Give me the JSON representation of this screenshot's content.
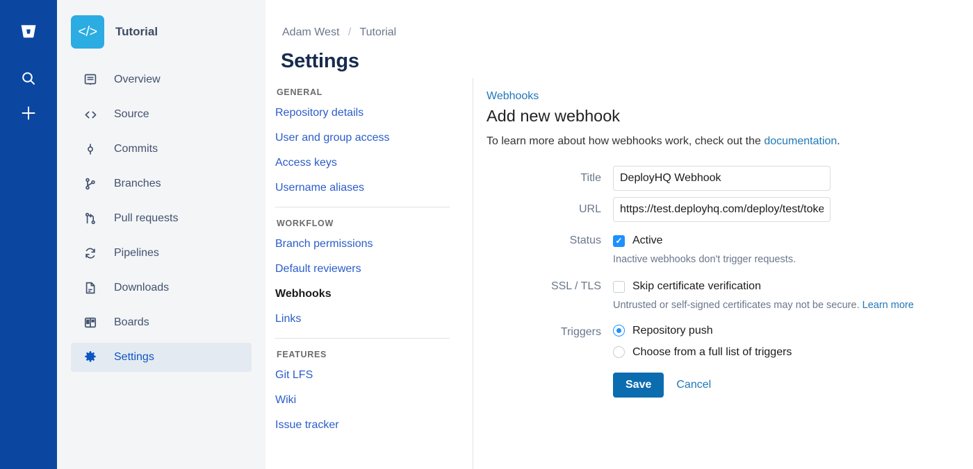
{
  "rail": {
    "logo_icon": "bitbucket-logo",
    "search_icon": "search-icon",
    "create_icon": "plus-icon"
  },
  "sidebar": {
    "repo": {
      "avatar_glyph": "</>",
      "name": "Tutorial"
    },
    "items": [
      {
        "label": "Overview",
        "icon": "overview-icon",
        "active": false
      },
      {
        "label": "Source",
        "icon": "code-icon",
        "active": false
      },
      {
        "label": "Commits",
        "icon": "commits-icon",
        "active": false
      },
      {
        "label": "Branches",
        "icon": "branches-icon",
        "active": false
      },
      {
        "label": "Pull requests",
        "icon": "pull-requests-icon",
        "active": false
      },
      {
        "label": "Pipelines",
        "icon": "pipelines-icon",
        "active": false
      },
      {
        "label": "Downloads",
        "icon": "downloads-icon",
        "active": false
      },
      {
        "label": "Boards",
        "icon": "boards-icon",
        "active": false
      },
      {
        "label": "Settings",
        "icon": "gear-icon",
        "active": true
      }
    ]
  },
  "breadcrumb": {
    "owner": "Adam West",
    "separator": "/",
    "repo": "Tutorial"
  },
  "page": {
    "title": "Settings"
  },
  "settings_nav": {
    "sections": [
      {
        "heading": "GENERAL",
        "links": [
          {
            "label": "Repository details",
            "current": false
          },
          {
            "label": "User and group access",
            "current": false
          },
          {
            "label": "Access keys",
            "current": false
          },
          {
            "label": "Username aliases",
            "current": false
          }
        ]
      },
      {
        "heading": "WORKFLOW",
        "links": [
          {
            "label": "Branch permissions",
            "current": false
          },
          {
            "label": "Default reviewers",
            "current": false
          },
          {
            "label": "Webhooks",
            "current": true
          },
          {
            "label": "Links",
            "current": false
          }
        ]
      },
      {
        "heading": "FEATURES",
        "links": [
          {
            "label": "Git LFS",
            "current": false
          },
          {
            "label": "Wiki",
            "current": false
          },
          {
            "label": "Issue tracker",
            "current": false
          }
        ]
      }
    ]
  },
  "webhook": {
    "eyebrow_link": "Webhooks",
    "title": "Add new webhook",
    "description_before": "To learn more about how webhooks work, check out the ",
    "description_link": "documentation",
    "description_after": ".",
    "fields": {
      "title_label": "Title",
      "title_value": "DeployHQ Webhook",
      "url_label": "URL",
      "url_value": "https://test.deployhq.com/deploy/test/token",
      "status_label": "Status",
      "status_checkbox_label": "Active",
      "status_checked": true,
      "status_helper": "Inactive webhooks don't trigger requests.",
      "ssl_label": "SSL / TLS",
      "ssl_checkbox_label": "Skip certificate verification",
      "ssl_checked": false,
      "ssl_helper_text": "Untrusted or self-signed certificates may not be secure. ",
      "ssl_helper_link": "Learn more",
      "triggers_label": "Triggers",
      "trigger_options": [
        {
          "label": "Repository push",
          "selected": true
        },
        {
          "label": "Choose from a full list of triggers",
          "selected": false
        }
      ]
    },
    "actions": {
      "save_label": "Save",
      "cancel_label": "Cancel"
    }
  },
  "colors": {
    "rail_blue": "#0B47A1",
    "sidebar_bg": "#F4F5F7",
    "repo_avatar": "#2BACE2",
    "link_blue": "#2A5DC8",
    "panel_link_blue": "#2077B8",
    "active_nav_blue": "#0B55C4",
    "active_nav_bg": "#E4EAF1",
    "control_blue": "#1E90FF",
    "button_blue": "#0B6CB0",
    "title_navy": "#172B4D",
    "muted_text": "#6B778C"
  }
}
